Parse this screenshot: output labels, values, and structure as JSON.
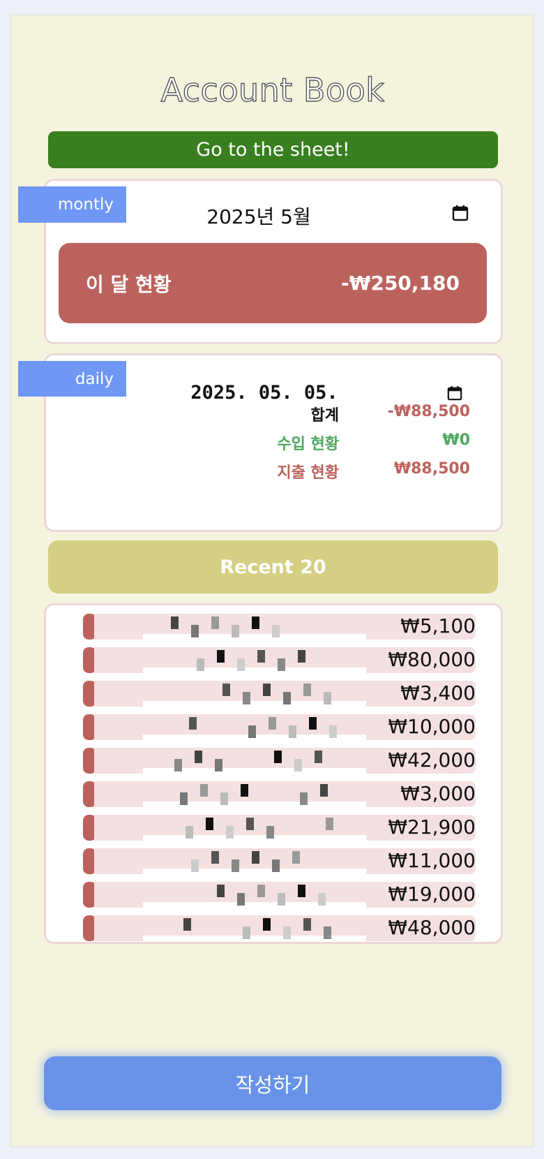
{
  "app": {
    "title": "Account Book",
    "sheet_button": "Go to the sheet!",
    "write_button": "작성하기"
  },
  "monthly": {
    "tag": "montly",
    "month": "2025년 5월",
    "status_label": "이 달 현황",
    "status_value": "-₩250,180",
    "calendar_icon": "calendar-icon"
  },
  "daily": {
    "tag": "daily",
    "date": "2025. 05. 05.",
    "calendar_icon": "calendar-icon",
    "summary": [
      {
        "label": "합계",
        "value": "-₩88,500",
        "color": "#bc625d",
        "label_color": "#111111"
      },
      {
        "label": "수입 현황",
        "value": "₩0",
        "color": "#4fa860",
        "label_color": "#4fa860"
      },
      {
        "label": "지출 현황",
        "value": "₩88,500",
        "color": "#bc625d",
        "label_color": "#bc625d"
      }
    ]
  },
  "recent": {
    "title": "Recent 20",
    "items": [
      {
        "amount": "₩5,100"
      },
      {
        "amount": "₩80,000"
      },
      {
        "amount": "₩3,400"
      },
      {
        "amount": "₩10,000"
      },
      {
        "amount": "₩42,000"
      },
      {
        "amount": "₩3,000"
      },
      {
        "amount": "₩21,900"
      },
      {
        "amount": "₩11,000"
      },
      {
        "amount": "₩19,000"
      },
      {
        "amount": "₩48,000"
      }
    ]
  },
  "colors": {
    "accent_green": "#397f20",
    "tag_blue": "#6f97f5",
    "negative_red": "#bc625d",
    "income_green": "#4fa860",
    "recent_yellow": "#d4cf82",
    "write_blue": "#6893e8"
  }
}
